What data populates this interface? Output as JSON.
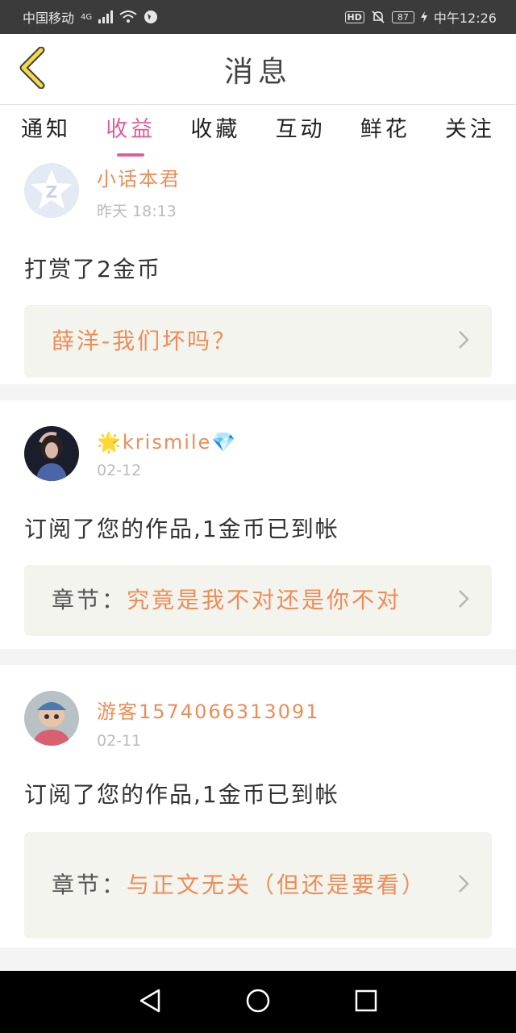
{
  "status_bar": {
    "carrier": "中国移动",
    "network": "4G",
    "hd": "HD",
    "battery": "87",
    "time": "中午12:26"
  },
  "header": {
    "title": "消息",
    "back_icon": "chevron-left-icon"
  },
  "tabs": [
    {
      "label": "通知",
      "active": false
    },
    {
      "label": "收益",
      "active": true
    },
    {
      "label": "收藏",
      "active": false
    },
    {
      "label": "互动",
      "active": false
    },
    {
      "label": "鲜花",
      "active": false
    },
    {
      "label": "关注",
      "active": false
    }
  ],
  "items": [
    {
      "username": "小话本君",
      "time": "昨天 18:13",
      "action": "打赏了2金币",
      "ref_prefix": "",
      "ref_title": "薛洋-我们坏吗？"
    },
    {
      "username": "🌟krismile💎",
      "time": "02-12",
      "action": "订阅了您的作品,1金币已到帐",
      "ref_prefix": "章节：",
      "ref_title": "究竟是我不对还是你不对"
    },
    {
      "username": "游客1574066313091",
      "time": "02-11",
      "action": "订阅了您的作品,1金币已到帐",
      "ref_prefix": "章节：",
      "ref_title": "与正文无关（但还是要看）"
    }
  ],
  "colors": {
    "accent_pink": "#e05d9c",
    "accent_orange": "#ee8c58"
  }
}
